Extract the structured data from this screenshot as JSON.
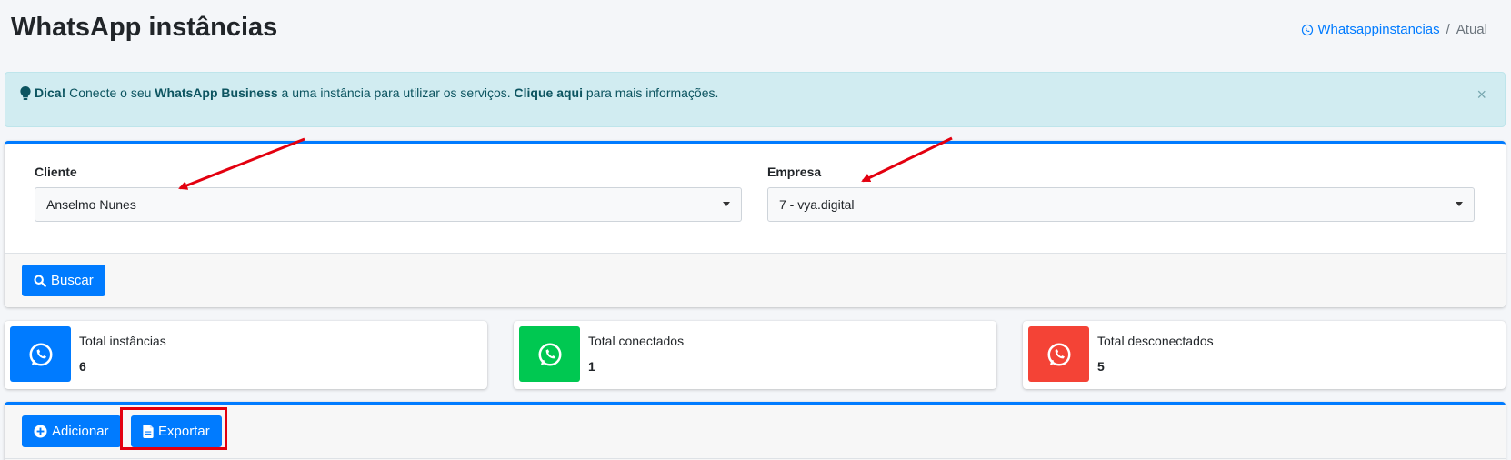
{
  "header": {
    "title": "WhatsApp instâncias",
    "breadcrumb": {
      "link_label": "Whatsappinstancias",
      "separator": "/",
      "current": "Atual"
    }
  },
  "alert": {
    "prefix": "Dica!",
    "text_1": " Conecte o seu ",
    "bold_1": "WhatsApp Business",
    "text_2": " a uma instância para utilizar os serviços. ",
    "bold_2": "Clique aqui",
    "text_3": " para mais informações.",
    "close_label": "×"
  },
  "filters": {
    "cliente": {
      "label": "Cliente",
      "value": "Anselmo Nunes"
    },
    "empresa": {
      "label": "Empresa",
      "value": "7 - vya.digital"
    },
    "search_button": "Buscar"
  },
  "stats": [
    {
      "label": "Total instâncias",
      "value": "6",
      "color": "#007bff"
    },
    {
      "label": "Total conectados",
      "value": "1",
      "color": "#00c851"
    },
    {
      "label": "Total desconectados",
      "value": "5",
      "color": "#f44336"
    }
  ],
  "actions": {
    "add_button": "Adicionar",
    "export_button": "Exportar"
  },
  "annotations": {
    "arrow_color": "#e3000f",
    "highlight_color": "#e3000f"
  }
}
